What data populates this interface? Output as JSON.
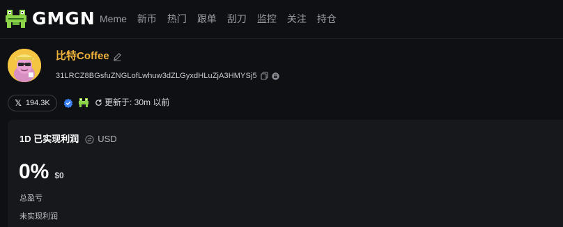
{
  "brand": {
    "name": "GMGN",
    "accent": "#f0b43c",
    "logo_green": "#8ed44b"
  },
  "nav": {
    "items": [
      "Meme",
      "新币",
      "热门",
      "跟单",
      "刮刀",
      "监控",
      "关注",
      "持仓"
    ]
  },
  "profile": {
    "name": "比特Coffee",
    "address": "31LRCZ8BGsfuZNGLofLwhuw3dZLGyxdHLuZjA3HMYSj5",
    "x_followers": "194.3K",
    "refresh_label": "更新于: 30m 以前"
  },
  "card": {
    "title": "1D 已实现利润",
    "currency": "USD",
    "pnl_percent": "0%",
    "pnl_usd": "$0",
    "total_label": "总盈亏",
    "unrealized_label": "未实现利润"
  },
  "icons": [
    "frog-logo-icon",
    "edit-icon",
    "copy-icon",
    "coin-icon",
    "x-icon",
    "verified-icon",
    "gmgn-mini-icon",
    "refresh-icon",
    "usd-swap-icon"
  ]
}
